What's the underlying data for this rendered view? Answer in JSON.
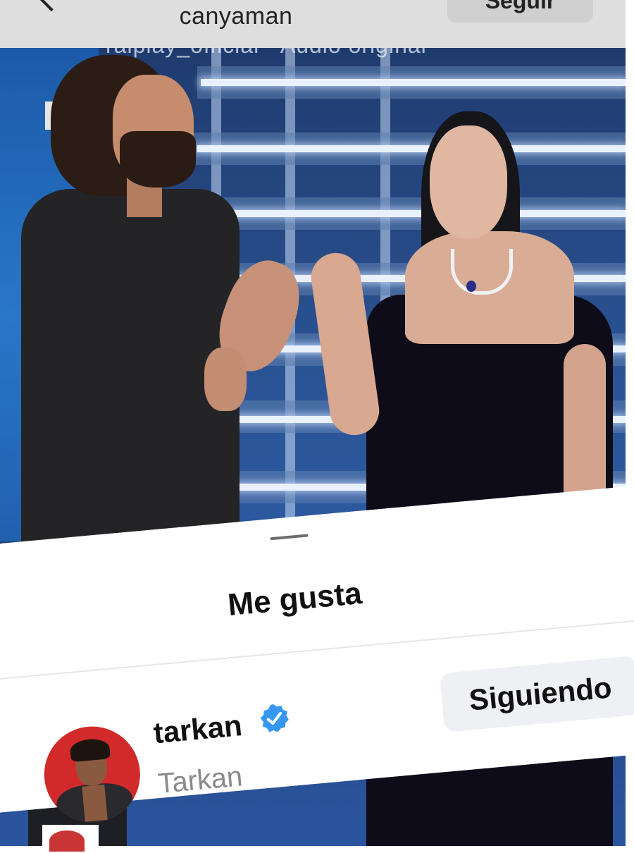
{
  "header": {
    "username": "canyaman",
    "follow_label": "Seguir"
  },
  "video": {
    "caption": "raiplay_official · Audio original",
    "channel_logo": "Rai"
  },
  "likes_sheet": {
    "title": "Me gusta",
    "users": [
      {
        "handle": "tarkan",
        "full_name": "Tarkan",
        "verified": true,
        "button_label": "Siguiendo",
        "avatar_bg": "#d22a2a"
      }
    ]
  },
  "colors": {
    "verified_badge": "#3797f0",
    "sheet_bg": "#ffffff",
    "secondary_text": "#8a8a8a",
    "button_bg": "#eff0f3"
  },
  "icons": {
    "back": "chevron-left-icon",
    "verified": "verified-badge-icon"
  }
}
